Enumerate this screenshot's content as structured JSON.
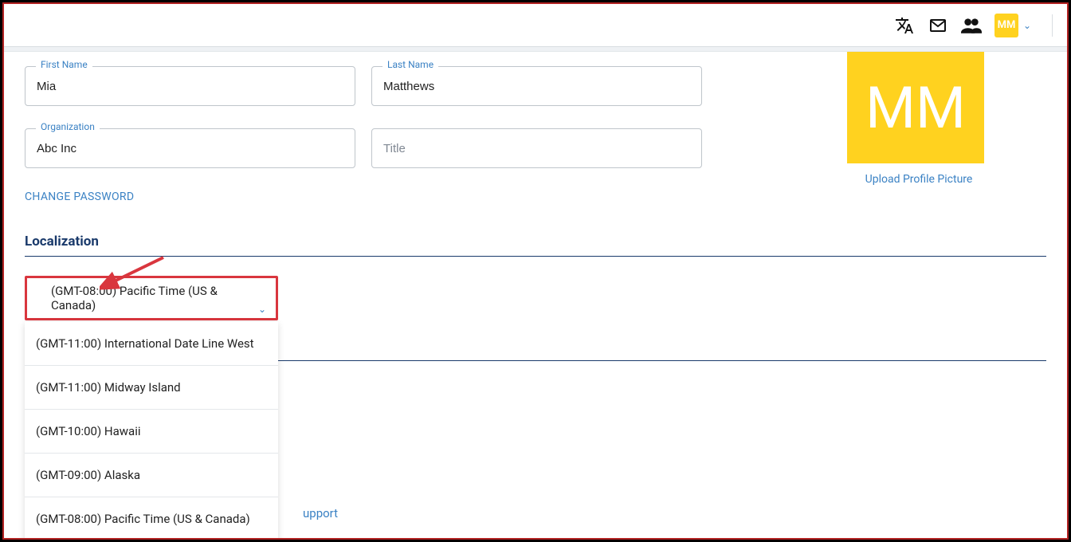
{
  "topbar": {
    "avatar_initials": "MM"
  },
  "profile": {
    "first_name_label": "First Name",
    "first_name_value": "Mia",
    "last_name_label": "Last Name",
    "last_name_value": "Matthews",
    "organization_label": "Organization",
    "organization_value": "Abc Inc",
    "title_placeholder": "Title",
    "avatar_initials": "MM",
    "upload_link": "Upload Profile Picture",
    "change_password": "Change Password"
  },
  "localization": {
    "section_title": "Localization",
    "selected": "(GMT-08:00) Pacific Time (US & Canada)",
    "options": {
      "0": "(GMT-11:00) International Date Line West",
      "1": "(GMT-11:00) Midway Island",
      "2": "(GMT-10:00) Hawaii",
      "3": "(GMT-09:00) Alaska",
      "4": "(GMT-08:00) Pacific Time (US & Canada)"
    }
  },
  "support": {
    "link_text": "upport"
  },
  "colors": {
    "accent_yellow": "#ffd21f",
    "link_blue": "#3b82c4",
    "highlight_red": "#d9363e",
    "dark_navy": "#1a3a6b"
  }
}
